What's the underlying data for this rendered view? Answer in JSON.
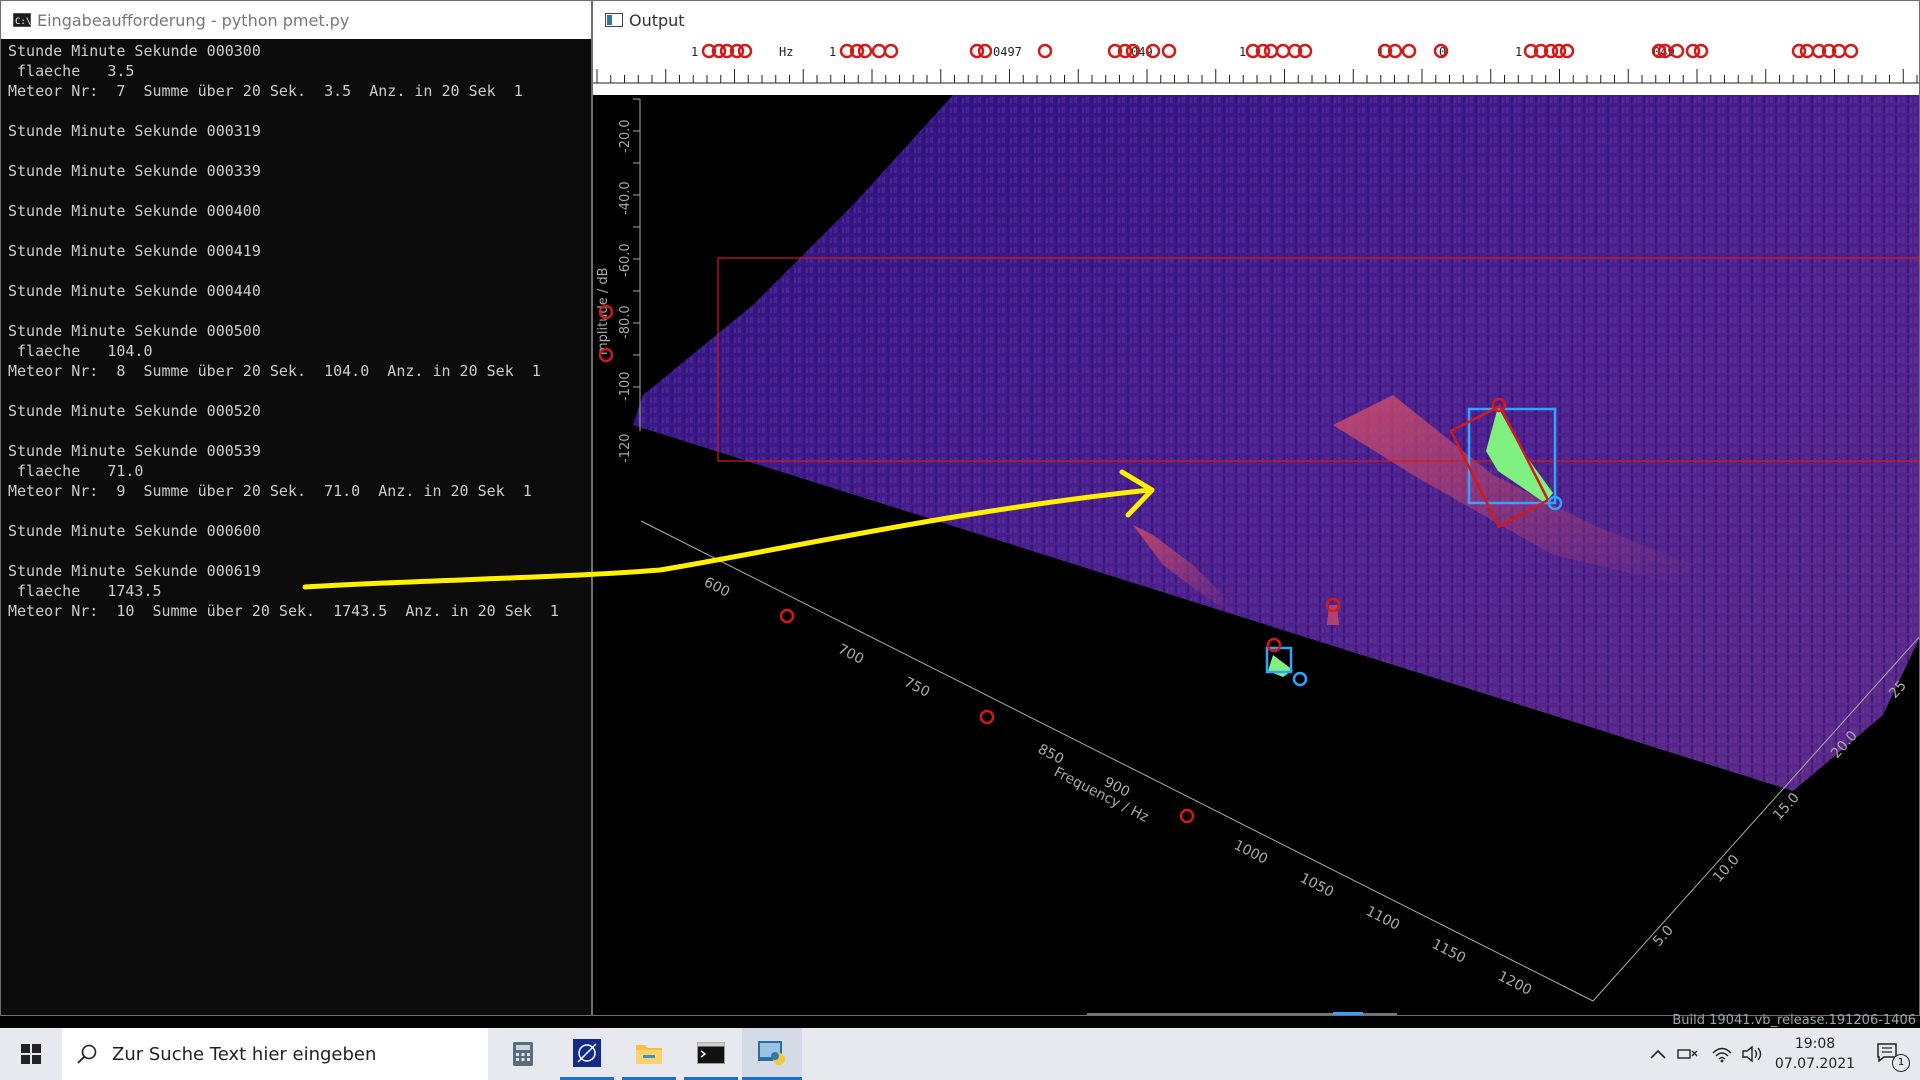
{
  "console_window": {
    "title": "Eingabeaufforderung - python  pmet.py",
    "lines": [
      "Stunde Minute Sekunde 000300",
      " flaeche   3.5",
      "Meteor Nr:  7  Summe über 20 Sek.  3.5  Anz. in 20 Sek  1",
      "",
      "Stunde Minute Sekunde 000319",
      "",
      "Stunde Minute Sekunde 000339",
      "",
      "Stunde Minute Sekunde 000400",
      "",
      "Stunde Minute Sekunde 000419",
      "",
      "Stunde Minute Sekunde 000440",
      "",
      "Stunde Minute Sekunde 000500",
      " flaeche   104.0",
      "Meteor Nr:  8  Summe über 20 Sek.  104.0  Anz. in 20 Sek  1",
      "",
      "Stunde Minute Sekunde 000520",
      "",
      "Stunde Minute Sekunde 000539",
      " flaeche   71.0",
      "Meteor Nr:  9  Summe über 20 Sek.  71.0  Anz. in 20 Sek  1",
      "",
      "Stunde Minute Sekunde 000600",
      "",
      "Stunde Minute Sekunde 000619",
      " flaeche   1743.5",
      "Meteor Nr:  10  Summe über 20 Sek.  1743.5  Anz. in 20 Sek  1"
    ]
  },
  "output_window": {
    "title": "Output",
    "ruler_labels": [
      "1",
      "Hz",
      "1",
      "0497",
      "049",
      "1",
      "1",
      "0",
      "1",
      "049"
    ],
    "axes": {
      "amplitude_label": "mplitude / dB",
      "amplitude_ticks": [
        "-20.0",
        "-40.0",
        "-60.0",
        "-80.0",
        "-100",
        "-120"
      ],
      "frequency_label": "Frequency / Hz",
      "frequency_ticks": [
        "600",
        "700",
        "750",
        "850",
        "900",
        "1000",
        "1050",
        "1100",
        "1150",
        "1200"
      ],
      "time_ticks": [
        "5.0",
        "10.0",
        "15.0",
        "20.0",
        "25"
      ]
    },
    "build_text": "Build 19041.vb_release.191206-1406"
  },
  "colors": {
    "annotation_arrow": "#ffef00",
    "selection_box": "#d11a1a",
    "detection_box": "#2fa3ff",
    "meteor_fill": "#80f080",
    "spectrum_base": "#3d1a8a"
  },
  "taskbar": {
    "search_placeholder": "Zur Suche Text hier eingeben",
    "apps": [
      "calculator-icon",
      "satellite-app-icon",
      "file-explorer-icon",
      "terminal-icon",
      "python-icon"
    ],
    "time": "19:08",
    "date": "07.07.2021",
    "notification_count": "1"
  }
}
